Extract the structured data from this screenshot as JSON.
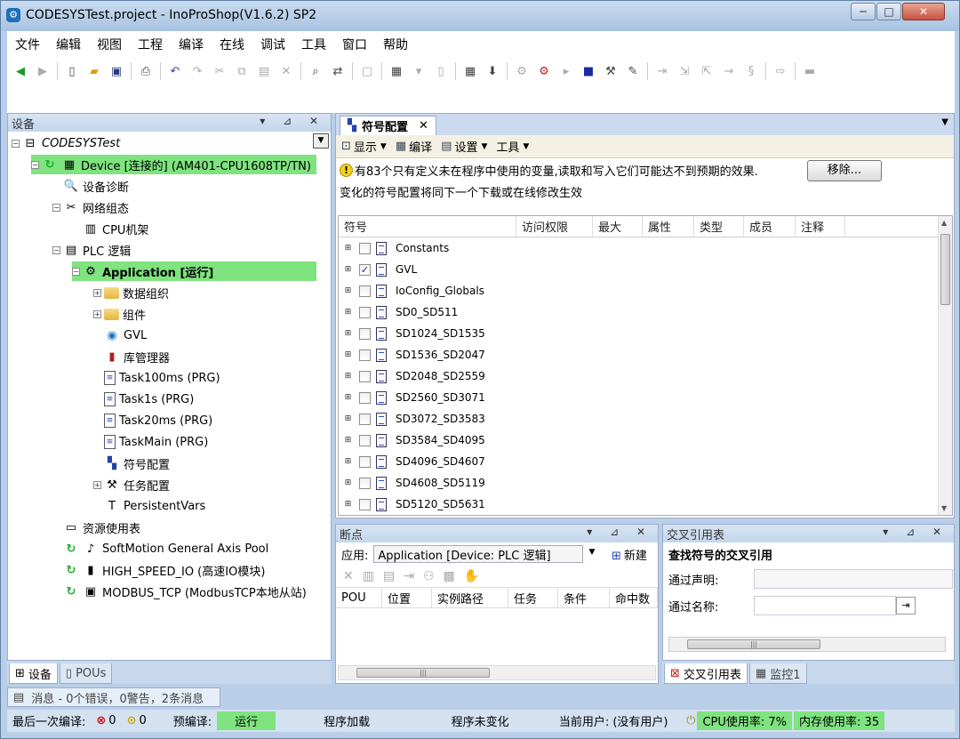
{
  "window": {
    "title": "CODESYSTest.project - InoProShop(V1.6.2) SP2",
    "controls": [
      "─",
      "□",
      "✕"
    ]
  },
  "menu": [
    "文件",
    "编辑",
    "视图",
    "工程",
    "编译",
    "在线",
    "调试",
    "工具",
    "窗口",
    "帮助"
  ],
  "device_panel": {
    "title": "设备",
    "controls": "▾ ⊿ ✕",
    "tree": [
      {
        "label": "CODESYSTest",
        "indent": 0,
        "exp": "−",
        "icon": "project-icon",
        "glyph": "⊟",
        "style": "italic"
      },
      {
        "label": "Device [连接的] (AM401-CPU1608TP/TN)",
        "indent": 1,
        "exp": "−",
        "icon": "device-icon",
        "glyph": "▦",
        "highlight": true,
        "sync": true
      },
      {
        "label": "设备诊断",
        "indent": 2,
        "icon": "diagnosis-icon",
        "glyph": "🔍"
      },
      {
        "label": "网络组态",
        "indent": 2,
        "exp": "−",
        "icon": "network-icon",
        "glyph": "✂"
      },
      {
        "label": "CPU机架",
        "indent": 3,
        "icon": "rack-icon",
        "glyph": "▥"
      },
      {
        "label": "PLC 逻辑",
        "indent": 2,
        "exp": "−",
        "icon": "plc-logic-icon",
        "glyph": "▤"
      },
      {
        "label": "Application [运行]",
        "indent": 3,
        "exp": "−",
        "icon": "application-gear-icon",
        "glyph": "⚙",
        "highlight": true,
        "bold": true
      },
      {
        "label": "数据组织",
        "indent": 4,
        "exp": "+",
        "icon": "folder-icon",
        "folder": true
      },
      {
        "label": "组件",
        "indent": 4,
        "exp": "+",
        "icon": "folder-icon",
        "folder": true
      },
      {
        "label": "GVL",
        "indent": 4,
        "icon": "globe-icon",
        "glyph": "◉"
      },
      {
        "label": "库管理器",
        "indent": 4,
        "icon": "library-icon",
        "glyph": "▮"
      },
      {
        "label": "Task100ms (PRG)",
        "indent": 4,
        "icon": "program-icon",
        "doc": true
      },
      {
        "label": "Task1s (PRG)",
        "indent": 4,
        "icon": "program-icon",
        "doc": true
      },
      {
        "label": "Task20ms (PRG)",
        "indent": 4,
        "icon": "program-icon",
        "doc": true
      },
      {
        "label": "TaskMain (PRG)",
        "indent": 4,
        "icon": "program-icon",
        "doc": true
      },
      {
        "label": "符号配置",
        "indent": 4,
        "icon": "symbol-config-icon",
        "glyph": "▚"
      },
      {
        "label": "任务配置",
        "indent": 4,
        "exp": "+",
        "icon": "task-config-icon",
        "glyph": "⚒"
      },
      {
        "label": "PersistentVars",
        "indent": 4,
        "icon": "persistent-icon",
        "glyph": "T"
      },
      {
        "label": "资源使用表",
        "indent": 2,
        "icon": "resource-icon",
        "glyph": "▭"
      },
      {
        "label": "SoftMotion General Axis Pool",
        "indent": 2,
        "icon": "axis-icon",
        "glyph": "♪",
        "sync": true
      },
      {
        "label": "HIGH_SPEED_IO (高速IO模块)",
        "indent": 2,
        "icon": "io-module-icon",
        "glyph": "▮",
        "sync": true
      },
      {
        "label": "MODBUS_TCP (ModbusTCP本地从站)",
        "indent": 2,
        "icon": "modbus-icon",
        "glyph": "▣",
        "sync": true
      }
    ]
  },
  "left_tabs": [
    "设备",
    "POUs"
  ],
  "messages_bar": "消息 - 0个错误，0警告，2条消息",
  "editor": {
    "tab": "符号配置",
    "toolbar": [
      "显示",
      "编译",
      "设置",
      "工具"
    ],
    "warning": "有83个只有定义未在程序中使用的变量,读取和写入它们可能达不到预期的效果.",
    "remove_button": "移除...",
    "info": "变化的符号配置将同下一个下载或在线修改生效",
    "columns": [
      "符号",
      "访问权限",
      "最大",
      "属性",
      "类型",
      "成员",
      "注释"
    ],
    "rows": [
      {
        "name": "Constants",
        "checked": false
      },
      {
        "name": "GVL",
        "checked": true
      },
      {
        "name": "IoConfig_Globals",
        "checked": false
      },
      {
        "name": "SD0_SD511",
        "checked": false
      },
      {
        "name": "SD1024_SD1535",
        "checked": false
      },
      {
        "name": "SD1536_SD2047",
        "checked": false
      },
      {
        "name": "SD2048_SD2559",
        "checked": false
      },
      {
        "name": "SD2560_SD3071",
        "checked": false
      },
      {
        "name": "SD3072_SD3583",
        "checked": false
      },
      {
        "name": "SD3584_SD4095",
        "checked": false
      },
      {
        "name": "SD4096_SD4607",
        "checked": false
      },
      {
        "name": "SD4608_SD5119",
        "checked": false
      },
      {
        "name": "SD5120_SD5631",
        "checked": false
      }
    ]
  },
  "breakpoints": {
    "title": "断点",
    "app_label": "应用:",
    "app_value": "Application [Device: PLC 逻辑]",
    "new_label": "新建",
    "columns": [
      "POU",
      "位置",
      "实例路径",
      "任务",
      "条件",
      "命中数"
    ]
  },
  "crossref": {
    "title": "交叉引用表",
    "heading": "查找符号的交叉引用",
    "by_decl": "通过声明:",
    "by_name": "通过名称:"
  },
  "right_tabs": [
    "交叉引用表",
    "监控1"
  ],
  "status": {
    "last_compile": "最后一次编译:",
    "errors": "0",
    "warnings": "0",
    "precompile": "预编译:",
    "run": "运行",
    "program_loaded": "程序加载",
    "program_unchanged": "程序未变化",
    "current_user": "当前用户: (没有用户)",
    "cpu": "CPU使用率: 7%",
    "mem": "内存使用率: 35"
  }
}
